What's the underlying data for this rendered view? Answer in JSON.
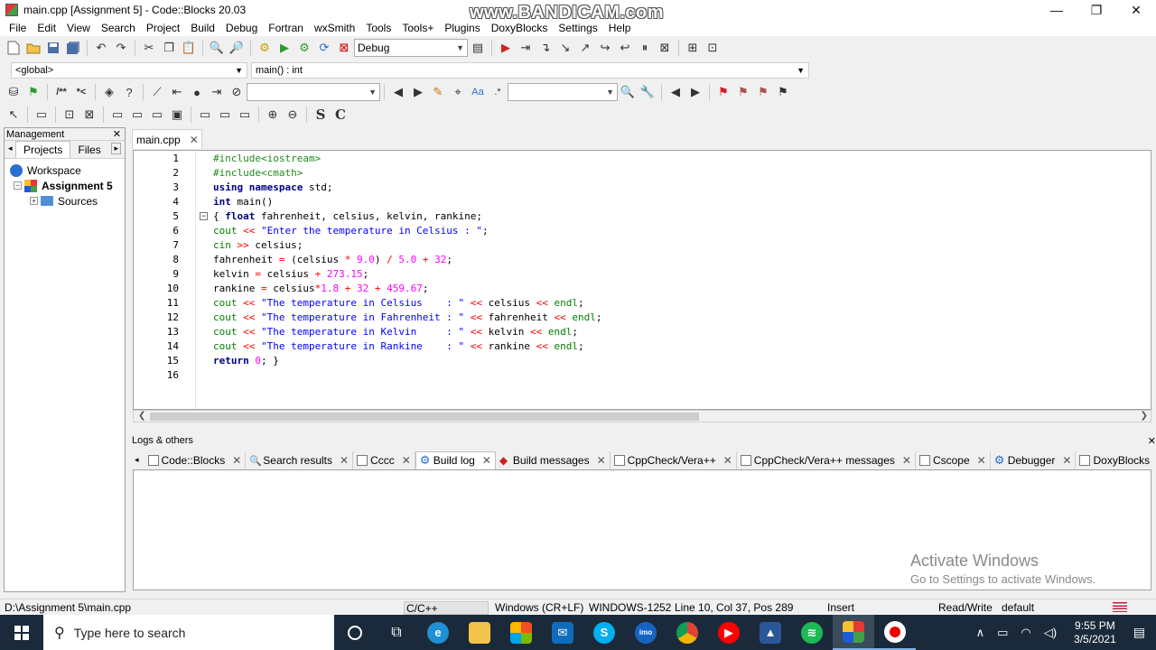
{
  "window": {
    "title": "main.cpp [Assignment 5] - Code::Blocks 20.03",
    "watermark": "www.BANDICAM.com",
    "minimize": "—",
    "maximize": "❐",
    "close": "✕"
  },
  "menu": [
    "File",
    "Edit",
    "View",
    "Search",
    "Project",
    "Build",
    "Debug",
    "Fortran",
    "wxSmith",
    "Tools",
    "Tools+",
    "Plugins",
    "DoxyBlocks",
    "Settings",
    "Help"
  ],
  "toolbar": {
    "build_target": "Debug"
  },
  "scope": {
    "scope": "<global>",
    "function": "main() : int"
  },
  "management": {
    "title": "Management",
    "close": "✕",
    "tabs": [
      "Projects",
      "Files"
    ],
    "tree": {
      "workspace": "Workspace",
      "project": "Assignment 5",
      "sources": "Sources"
    }
  },
  "editor": {
    "tab_label": "main.cpp",
    "tab_close": "✕",
    "line_numbers": [
      "1",
      "2",
      "3",
      "4",
      "5",
      "6",
      "7",
      "8",
      "9",
      "10",
      "11",
      "12",
      "13",
      "14",
      "15",
      "16"
    ]
  },
  "logs": {
    "title": "Logs & others",
    "close": "✕",
    "tabs": [
      "Code::Blocks",
      "Search results",
      "Cccc",
      "Build log",
      "Build messages",
      "CppCheck/Vera++",
      "CppCheck/Vera++ messages",
      "Cscope",
      "Debugger",
      "DoxyBlocks"
    ],
    "active_tab": "Build log"
  },
  "watermark_activate": {
    "line1": "Activate Windows",
    "line2": "Go to Settings to activate Windows."
  },
  "status": {
    "path": "D:\\Assignment 5\\main.cpp",
    "language": "C/C++",
    "line_endings": "Windows (CR+LF)",
    "encoding": "WINDOWS-1252",
    "position": "Line 10, Col 37, Pos 289",
    "insert_mode": "Insert",
    "access": "Read/Write",
    "profile": "default"
  },
  "taskbar": {
    "search_placeholder": "Type here to search",
    "time": "9:55 PM",
    "date": "3/5/2021"
  },
  "colors": {
    "preprocessor": "#1e8a1e",
    "keyword": "#000080",
    "string": "#0000ff",
    "number": "#ff00ff",
    "operator": "#ff0000",
    "taskbar": "#1b2a3a"
  }
}
